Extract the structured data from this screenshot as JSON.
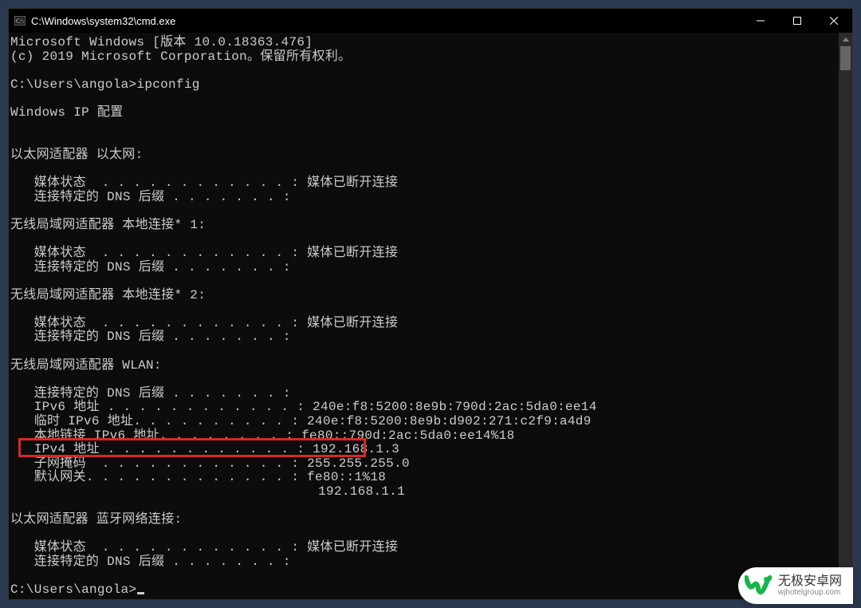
{
  "window": {
    "title": "C:\\Windows\\system32\\cmd.exe"
  },
  "terminal": {
    "header1": "Microsoft Windows [版本 10.0.18363.476]",
    "header2": "(c) 2019 Microsoft Corporation。保留所有权利。",
    "prompt1": "C:\\Users\\angola>ipconfig",
    "wip_header": "Windows IP 配置",
    "eth_header": "以太网适配器 以太网:",
    "eth_media": "   媒体状态  . . . . . . . . . . . . : 媒体已断开连接",
    "eth_dns": "   连接特定的 DNS 后缀 . . . . . . . :",
    "wlan1_header": "无线局域网适配器 本地连接* 1:",
    "wlan1_media": "   媒体状态  . . . . . . . . . . . . : 媒体已断开连接",
    "wlan1_dns": "   连接特定的 DNS 后缀 . . . . . . . :",
    "wlan2_header": "无线局域网适配器 本地连接* 2:",
    "wlan2_media": "   媒体状态  . . . . . . . . . . . . : 媒体已断开连接",
    "wlan2_dns": "   连接特定的 DNS 后缀 . . . . . . . :",
    "wlan_header": "无线局域网适配器 WLAN:",
    "wlan_dns": "   连接特定的 DNS 后缀 . . . . . . . :",
    "wlan_ipv6": "   IPv6 地址 . . . . . . . . . . . . : 240e:f8:5200:8e9b:790d:2ac:5da0:ee14",
    "wlan_tipv6": "   临时 IPv6 地址. . . . . . . . . . : 240e:f8:5200:8e9b:d902:271:c2f9:a4d9",
    "wlan_llipv6": "   本地链接 IPv6 地址. . . . . . . . : fe80::790d:2ac:5da0:ee14%18",
    "wlan_ipv4": "   IPv4 地址 . . . . . . . . . . . . : 192.168.1.3",
    "wlan_mask": "   子网掩码  . . . . . . . . . . . . : 255.255.255.0",
    "wlan_gw1": "   默认网关. . . . . . . . . . . . . : fe80::1%18",
    "wlan_gw2": "                                       192.168.1.1",
    "bt_header": "以太网适配器 蓝牙网络连接:",
    "bt_media": "   媒体状态  . . . . . . . . . . . . : 媒体已断开连接",
    "bt_dns": "   连接特定的 DNS 后缀 . . . . . . . :",
    "prompt2": "C:\\Users\\angola>"
  },
  "watermark": {
    "title": "无极安卓网",
    "url": "wjhotelgroup.com"
  }
}
